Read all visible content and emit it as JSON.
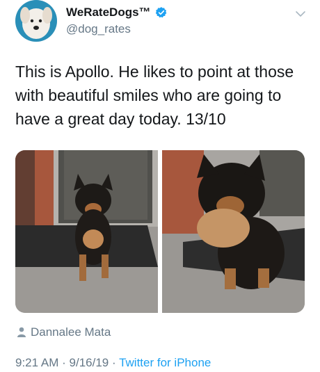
{
  "header": {
    "display_name": "WeRateDogs™",
    "handle": "@dog_rates"
  },
  "tweet": {
    "text": "This is Apollo. He likes to point at those with beautiful smiles who are going to have a great day today. 13/10"
  },
  "media": {
    "photo_credit": "Dannalee Mata"
  },
  "meta": {
    "time": "9:21 AM",
    "separator": "·",
    "date": "9/16/19",
    "source": "Twitter for iPhone"
  },
  "colors": {
    "text": "#14171a",
    "secondary": "#657786",
    "accent": "#1da1f2"
  },
  "icons": [
    "verified-badge-icon",
    "chevron-down-icon",
    "person-icon"
  ]
}
